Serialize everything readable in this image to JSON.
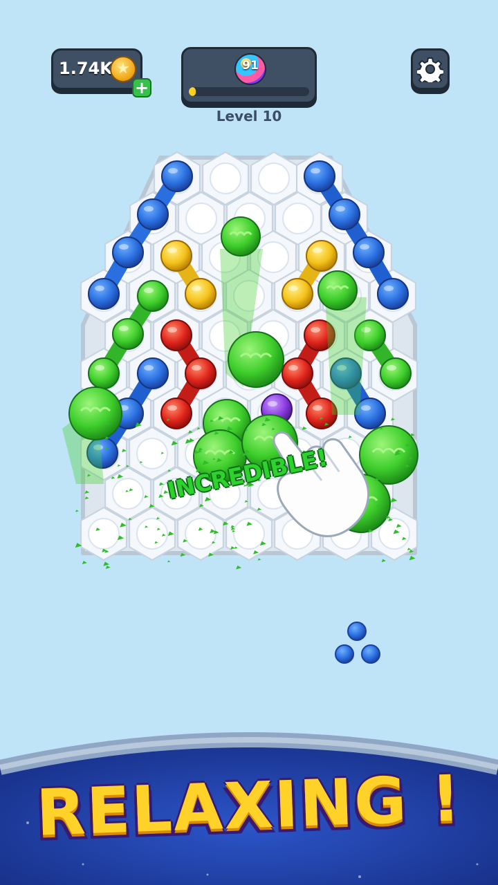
{
  "hud": {
    "coins": "1.74K",
    "coin_icon": "coin-icon",
    "add_icon": "plus-icon",
    "balls_remaining": "91",
    "progress": 0.06,
    "level_label": "Level 10",
    "settings_icon": "gear-icon"
  },
  "board": {
    "combo_text": "INCREDIBLE!",
    "colors": {
      "blue": "#2a6fe0",
      "yellow": "#f5c21b",
      "green": "#3fcf2c",
      "red": "#e0251c",
      "purple": "#8a3be0",
      "board": "#f4f7fb",
      "board_edge": "#c7d3df"
    }
  },
  "banner": {
    "text": "RELAXING !",
    "background": "#1b3a9a",
    "rim": "#8fa6c4",
    "text_color": "#ffd22a"
  }
}
